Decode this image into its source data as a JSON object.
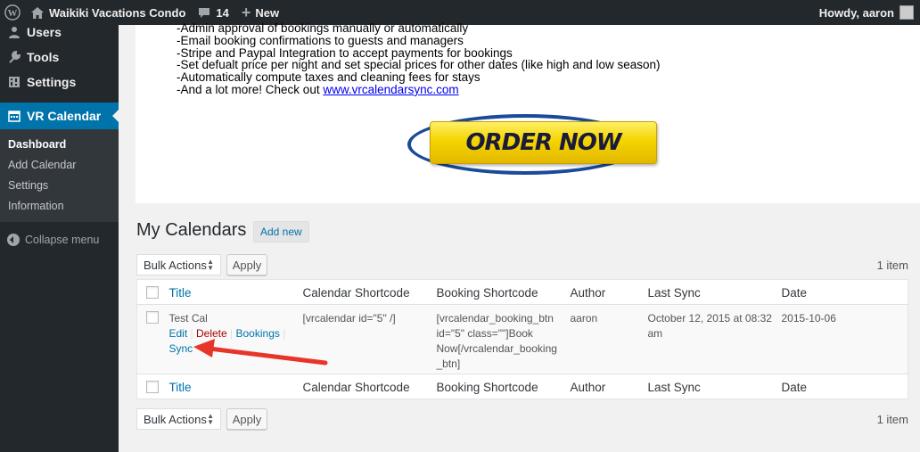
{
  "adminbar": {
    "site_name": "Waikiki Vacations Condo",
    "comments_count": "14",
    "new_label": "New",
    "howdy": "Howdy, aaron"
  },
  "sidebar": {
    "items": [
      {
        "label": "Users",
        "icon": "users-icon"
      },
      {
        "label": "Tools",
        "icon": "wrench-icon"
      },
      {
        "label": "Settings",
        "icon": "settings-icon"
      }
    ],
    "current": {
      "label": "VR Calendar",
      "icon": "calendar-icon"
    },
    "submenu": [
      "Dashboard",
      "Add Calendar",
      "Settings",
      "Information"
    ],
    "collapse_label": "Collapse menu"
  },
  "promo": {
    "lines": [
      "-Admin approval of bookings manually or automatically",
      "-Email booking confirmations to guests and managers",
      "-Stripe and Paypal Integration to accept payments for bookings",
      "-Set defualt price per night and set special prices for other dates (like high and low season)",
      "-Automatically compute taxes and cleaning fees for stays"
    ],
    "last_line_prefix": "-And a lot more! Check out ",
    "link_text": "www.vrcalendarsync.com",
    "order_label": "ORDER NOW"
  },
  "page": {
    "title": "My Calendars",
    "add_new": "Add new"
  },
  "tablenav": {
    "bulk_actions": "Bulk Actions",
    "apply": "Apply",
    "items_count": "1 item"
  },
  "table": {
    "columns": [
      "Title",
      "Calendar Shortcode",
      "Booking Shortcode",
      "Author",
      "Last Sync",
      "Date"
    ],
    "rows": [
      {
        "title": "Test Cal",
        "actions": {
          "edit": "Edit",
          "delete": "Delete",
          "bookings": "Bookings",
          "sync": "Sync"
        },
        "calendar_shortcode": "[vrcalendar id=\"5\" /]",
        "booking_shortcode": [
          "[vrcalendar_booking_btn",
          "id=\"5\" class=\"\"]Book",
          "Now[/vrcalendar_booking",
          "_btn]"
        ],
        "author": "aaron",
        "last_sync": [
          "October 12, 2015 at 08:32",
          "am"
        ],
        "date": "2015-10-06"
      }
    ]
  },
  "colors": {
    "adminbar_bg": "#23282d",
    "accent": "#0073aa",
    "delete": "#aa0000",
    "arrow": "#e8352a"
  }
}
